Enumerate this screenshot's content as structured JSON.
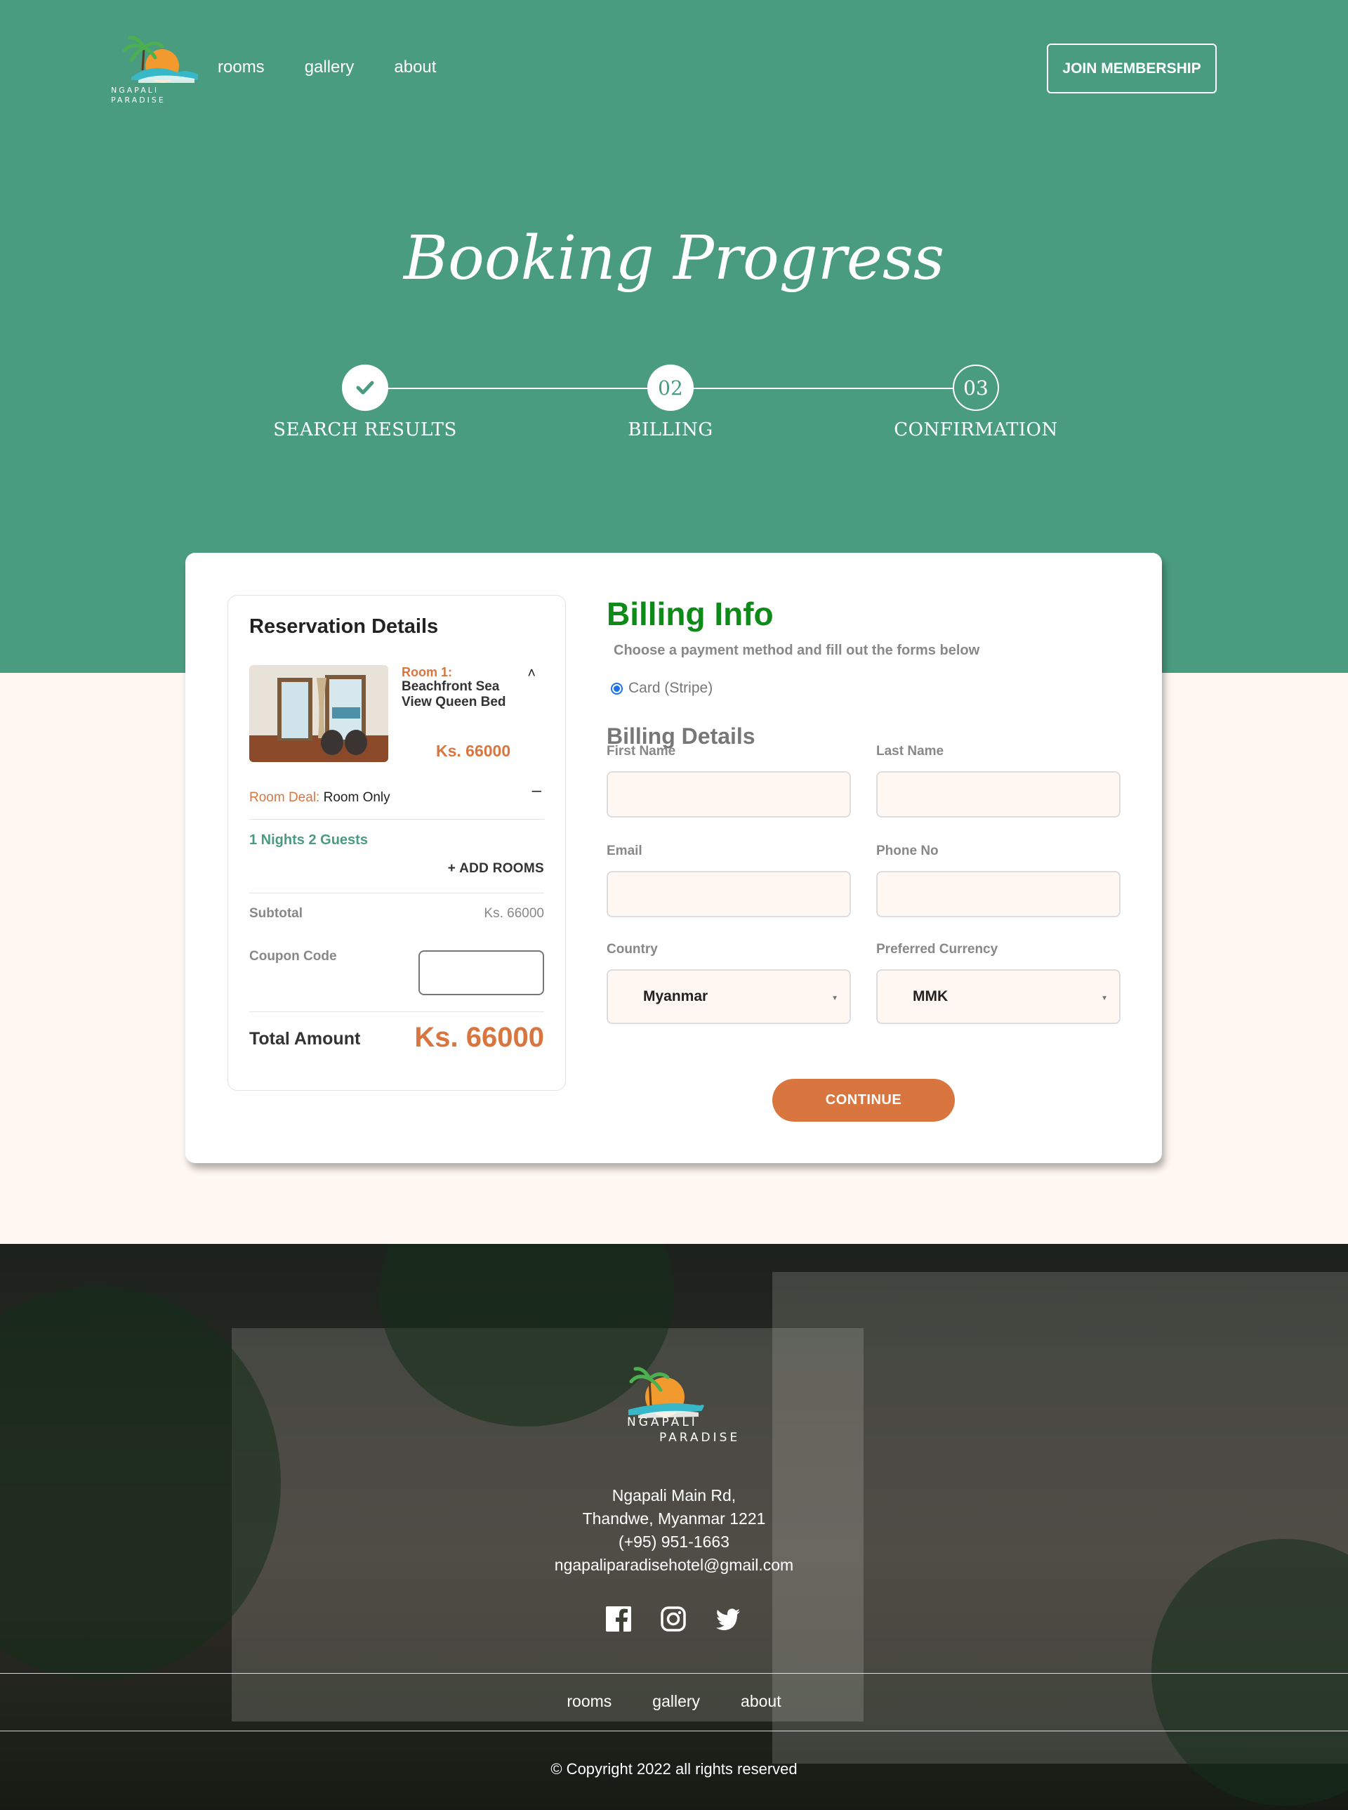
{
  "header": {
    "logo_line1": "NGAPALI",
    "logo_line2": "PARADISE",
    "nav": [
      "rooms",
      "gallery",
      "about"
    ],
    "join_label": "JOIN MEMBERSHIP"
  },
  "hero": {
    "title": "Booking Progress",
    "steps": [
      {
        "number": "",
        "label": "SEARCH RESULTS",
        "state": "done"
      },
      {
        "number": "02",
        "label": "BILLING",
        "state": "active"
      },
      {
        "number": "03",
        "label": "CONFIRMATION",
        "state": "pending"
      }
    ]
  },
  "reservation": {
    "title": "Reservation Details",
    "room_label": "Room 1:",
    "room_name": "Beachfront Sea View Queen Bed",
    "room_price": "Ks. 66000",
    "deal_key": "Room Deal:",
    "deal_value": "Room Only",
    "nights_guests": "1 Nights 2 Guests",
    "add_rooms": "+ ADD ROOMS",
    "subtotal_label": "Subtotal",
    "subtotal_value": "Ks. 66000",
    "coupon_label": "Coupon Code",
    "coupon_value": "",
    "total_label": "Total Amount",
    "total_value": "Ks. 66000"
  },
  "billing": {
    "title": "Billing Info",
    "subtitle": "Choose a payment method and fill out the forms below",
    "payment_option": "Card (Stripe)",
    "details_title": "Billing Details",
    "first_name_label": "First Name",
    "last_name_label": "Last Name",
    "email_label": "Email",
    "phone_label": "Phone No",
    "country_label": "Country",
    "country_value": "Myanmar",
    "currency_label": "Preferred Currency",
    "currency_value": "MMK",
    "continue_label": "CONTINUE"
  },
  "footer": {
    "logo_line1": "NGAPALI",
    "logo_line2": "PARADISE",
    "address_line1": "Ngapali Main Rd,",
    "address_line2": "Thandwe, Myanmar 1221",
    "phone": "(+95) 951-1663",
    "email": "ngapaliparadisehotel@gmail.com",
    "socials": [
      "facebook-icon",
      "instagram-icon",
      "twitter-icon"
    ],
    "nav": [
      "rooms",
      "gallery",
      "about"
    ],
    "copyright": "© Copyright 2022 all rights reserved"
  },
  "colors": {
    "hero_green": "#4a9c80",
    "accent_orange": "#d97640",
    "billing_green": "#0d8a18",
    "page_bg": "#fff7f1"
  }
}
